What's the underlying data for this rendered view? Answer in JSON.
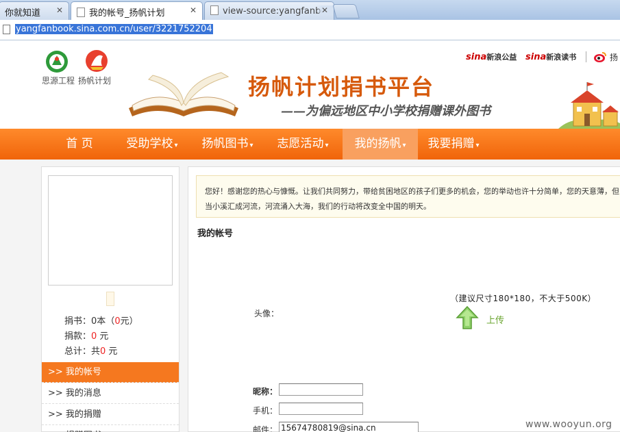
{
  "tabs": [
    {
      "label": "你就知道"
    },
    {
      "label": "我的帐号_扬帆计划"
    },
    {
      "label": "view-source:yangfanbook"
    }
  ],
  "address": {
    "url": "yangfanbook.sina.com.cn/user/3221752204"
  },
  "header": {
    "logos": [
      {
        "label": "思源工程"
      },
      {
        "label": "扬帆计划"
      }
    ],
    "title": "扬帆计划捐书平台",
    "subtitle": "——为偏远地区中小学校捐赠课外图书",
    "links": [
      {
        "brand": "sina",
        "label": "新浪公益"
      },
      {
        "brand": "sina",
        "label": "新浪读书"
      }
    ],
    "weibo_text": "扬"
  },
  "nav": {
    "items": [
      {
        "label": "首 页",
        "dropdown": false
      },
      {
        "label": "受助学校",
        "dropdown": true
      },
      {
        "label": "扬帆图书",
        "dropdown": true
      },
      {
        "label": "志愿活动",
        "dropdown": true
      },
      {
        "label": "我的扬帆",
        "dropdown": true
      },
      {
        "label": "我要捐赠",
        "dropdown": true
      }
    ],
    "caret": "▾"
  },
  "sidebar": {
    "stats": {
      "books_prefix": "捐书：",
      "books_count": "0",
      "books_unit": "本（",
      "books_money": "0",
      "books_suffix": "元）",
      "money_prefix": "捐款：",
      "money_value": "0",
      "money_suffix": " 元",
      "total_prefix": "总计：共",
      "total_value": "0",
      "total_suffix": " 元"
    },
    "menu": [
      {
        "label": ">> 我的帐号"
      },
      {
        "label": ">> 我的消息"
      },
      {
        "label": ">> 我的捐赠"
      },
      {
        "label": ">> 捐赠图书"
      }
    ]
  },
  "main": {
    "notice": "您好！感谢您的热心与慷慨。让我们共同努力，带给贫困地区的孩子们更多的机会，您的举动也许十分简单，您的天意薄，但当小溪汇成河流，河流涌入大海，我们的行动将改变全中国的明天。",
    "section_title": "我的帐号",
    "avatar_hint": "（建议尺寸180*180，不大于500K）",
    "avatar_label": "头像：",
    "upload_label": "上传",
    "fields": [
      {
        "label": "昵称：",
        "value": ""
      },
      {
        "label": "手机：",
        "value": ""
      },
      {
        "label": "邮件：",
        "value": "15674780819@sina.cn"
      }
    ]
  },
  "watermark": "www.wooyun.org",
  "colors": {
    "nav_orange": "#f0640a",
    "active_menu": "#f5781f",
    "title_orange": "#d65a0c",
    "url_highlight": "#3874d8"
  }
}
